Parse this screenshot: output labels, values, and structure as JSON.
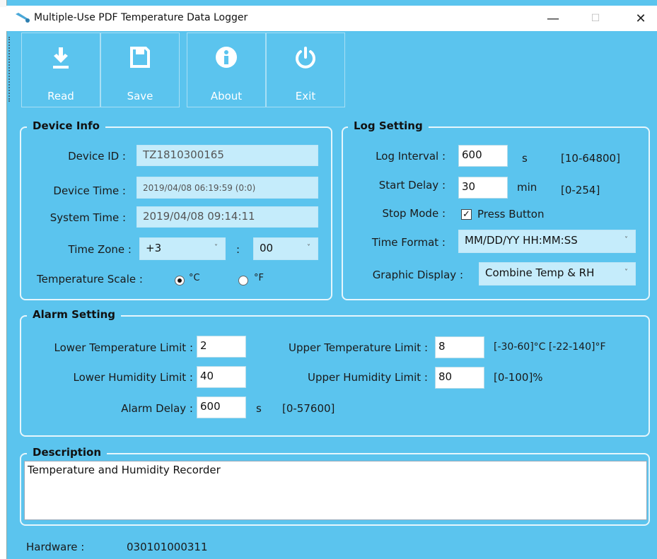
{
  "window": {
    "title": "Multiple-Use PDF Temperature Data Logger",
    "minimize": "—",
    "maximize": "☐",
    "close": "✕"
  },
  "toolbar": {
    "read": "Read",
    "save": "Save",
    "about": "About",
    "exit": "Exit"
  },
  "device_info": {
    "title": "Device Info",
    "device_id_label": "Device ID :",
    "device_id": "TZ1810300165",
    "device_time_label": "Device Time :",
    "device_time": "2019/04/08 06:19:59 (0:0)",
    "system_time_label": "System Time :",
    "system_time": "2019/04/08 09:14:11",
    "time_zone_label": "Time Zone :",
    "time_zone_hours": "+3",
    "tz_sep": ":",
    "time_zone_minutes": "00",
    "temp_scale_label": "Temperature Scale :",
    "celsius": "°C",
    "fahrenheit": "°F",
    "selected_scale": "C"
  },
  "log_setting": {
    "title": "Log Setting",
    "log_interval_label": "Log Interval :",
    "log_interval": "600",
    "log_interval_unit": "s",
    "log_interval_range": "[10-64800]",
    "start_delay_label": "Start Delay :",
    "start_delay": "30",
    "start_delay_unit": "min",
    "start_delay_range": "[0-254]",
    "stop_mode_label": "Stop Mode :",
    "stop_mode_option": "Press Button",
    "stop_mode_checked": true,
    "time_format_label": "Time Format :",
    "time_format": "MM/DD/YY HH:MM:SS",
    "graphic_display_label": "Graphic Display :",
    "graphic_display": "Combine Temp & RH"
  },
  "alarm_setting": {
    "title": "Alarm Setting",
    "lower_temp_label": "Lower Temperature Limit :",
    "lower_temp": "2",
    "upper_temp_label": "Upper Temperature Limit :",
    "upper_temp": "8",
    "temp_range": "[-30-60]°C  [-22-140]°F",
    "lower_hum_label": "Lower Humidity Limit :",
    "lower_hum": "40",
    "upper_hum_label": "Upper Humidity Limit :",
    "upper_hum": "80",
    "hum_range": "[0-100]%",
    "alarm_delay_label": "Alarm Delay :",
    "alarm_delay": "600",
    "alarm_delay_unit": "s",
    "alarm_delay_range": "[0-57600]"
  },
  "description": {
    "title": "Description",
    "text": "Temperature and Humidity Recorder"
  },
  "footer": {
    "hardware_label": "Hardware :",
    "hardware": "030101000311"
  },
  "colors": {
    "panel": "#5bc4ee",
    "readonly_field": "#c5ecfb",
    "group_border": "#e6f6fc"
  }
}
